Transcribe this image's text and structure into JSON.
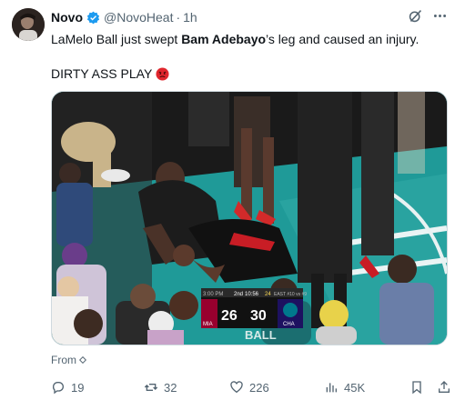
{
  "user": {
    "name": "Novo",
    "handle": "@NovoHeat",
    "separator": "·",
    "time": "1h"
  },
  "tweet": {
    "text_before": "LaMelo Ball just swept ",
    "text_bold": "Bam Adebayo",
    "text_after": "’s leg and caused an injury.",
    "line2": "DIRTY ASS PLAY"
  },
  "scoreboard": {
    "home_abbr": "MIA",
    "away_abbr": "CHA",
    "home_score": "26",
    "away_score": "30",
    "clock": "10:56",
    "quarter": "2nd",
    "shot_clock": "24",
    "banner": "EAST #10 vs #9"
  },
  "jersey": {
    "text": "BALL"
  },
  "from_label": "From",
  "actions": {
    "replies": "19",
    "reposts": "32",
    "likes": "226",
    "views": "45K"
  },
  "colors": {
    "verified": "#1d9bf0",
    "text_secondary": "#536471",
    "court_teal": "#1b8c8c"
  }
}
